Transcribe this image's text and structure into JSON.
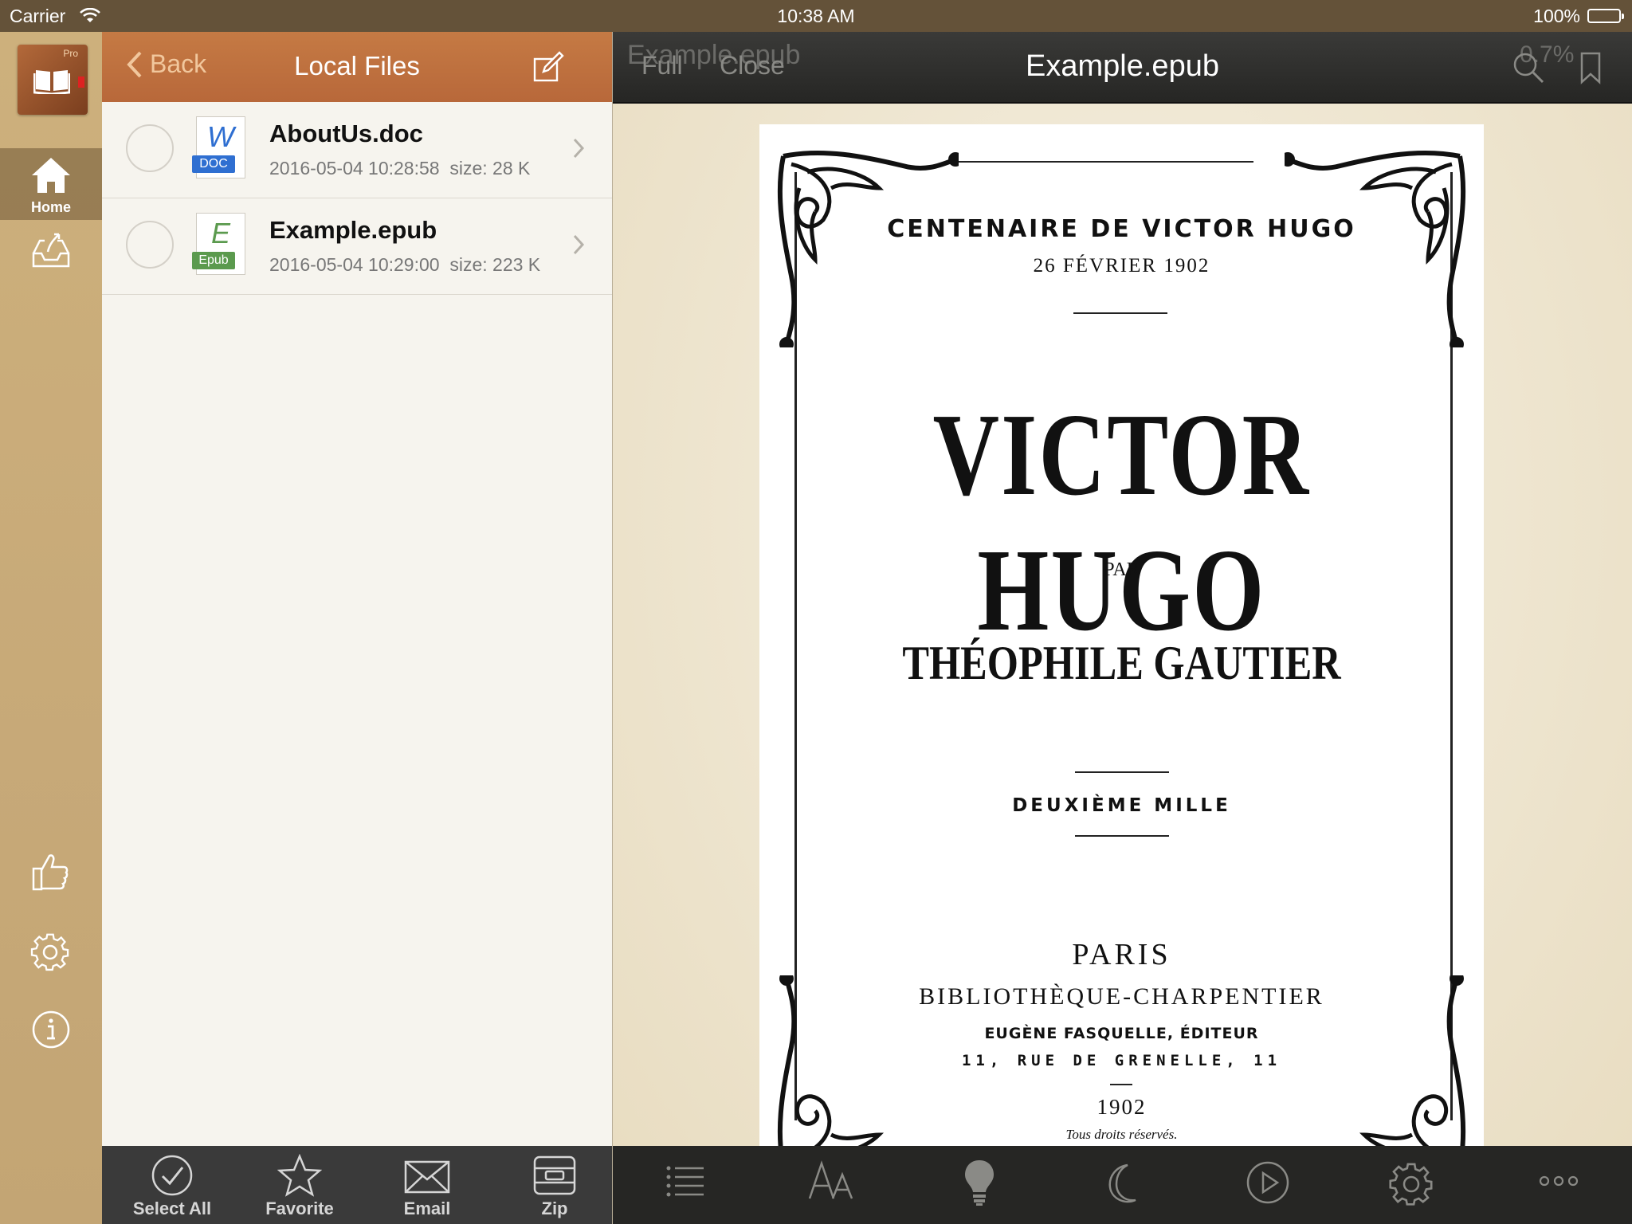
{
  "status_bar": {
    "carrier": "Carrier",
    "time": "10:38 AM",
    "battery": "100%"
  },
  "sidebar": {
    "logo_badge": "Pro",
    "items": [
      {
        "label": "Home",
        "icon": "home-icon",
        "selected": true
      },
      {
        "label": "",
        "icon": "inbox-icon"
      },
      {
        "label": "",
        "icon": "thumbs-up-icon"
      },
      {
        "label": "",
        "icon": "gear-icon"
      },
      {
        "label": "",
        "icon": "info-icon"
      }
    ]
  },
  "files_panel": {
    "back_label": "Back",
    "title": "Local Files",
    "files": [
      {
        "name": "AboutUs.doc",
        "date": "2016-05-04 10:28:58",
        "size": "size: 28 K",
        "type_letter": "W",
        "type_badge": "DOC",
        "badge_color": "#2f6fd1",
        "letter_color": "#2f6fd1"
      },
      {
        "name": "Example.epub",
        "date": "2016-05-04 10:29:00",
        "size": "size: 223 K",
        "type_letter": "E",
        "type_badge": "Epub",
        "badge_color": "#5b9a4e",
        "letter_color": "#5b9a4e"
      }
    ],
    "toolbar": {
      "select_all": "Select All",
      "favorite": "Favorite",
      "email": "Email",
      "zip": "Zip"
    }
  },
  "reader": {
    "ghost_title": "Example.epub",
    "ghost_progress": "0.7%",
    "full_label": "Full",
    "close_label": "Close",
    "title": "Example.epub",
    "page": {
      "centenaire": "CENTENAIRE DE VICTOR HUGO",
      "date": "26 FÉVRIER 1902",
      "author_title": "VICTOR HUGO",
      "par": "PAR",
      "gautier": "THÉOPHILE GAUTIER",
      "edition": "DEUXIÈME MILLE",
      "city": "PARIS",
      "publisher": "BIBLIOTHÈQUE-CHARPENTIER",
      "editor": "EUGÈNE FASQUELLE, ÉDITEUR",
      "address": "11, RUE DE GRENELLE, 11",
      "year": "1902",
      "rights": "Tous droits réservés."
    },
    "toolbar_icons": [
      "list-icon",
      "font-size-icon",
      "lightbulb-icon",
      "moon-icon",
      "play-icon",
      "gear-icon",
      "more-icon"
    ]
  }
}
